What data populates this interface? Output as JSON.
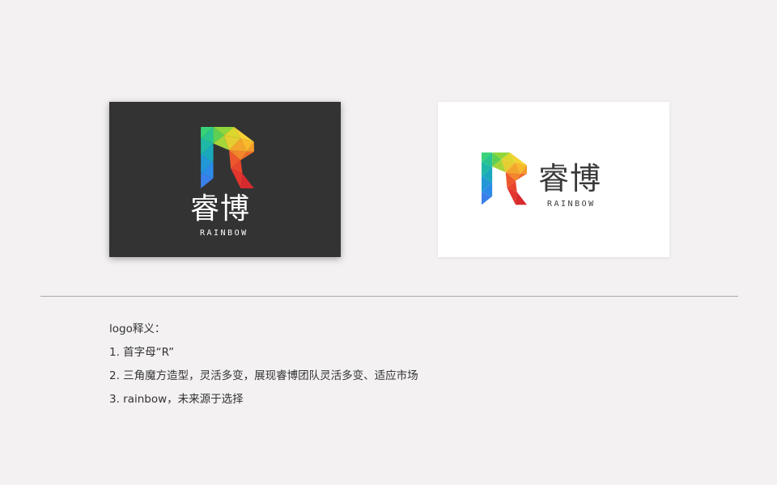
{
  "brand": {
    "name_cn": "睿博",
    "name_en": "RAINBOW"
  },
  "cards": {
    "dark_background": "#333333",
    "light_background": "#ffffff"
  },
  "logo_colors": {
    "green": "#2fc86e",
    "teal": "#1fb59a",
    "blue": "#2d8ee8",
    "yellow": "#f7d233",
    "orange": "#f59a2a",
    "red": "#e8382e"
  },
  "description": {
    "title": "logo释义：",
    "items": [
      "1. 首字母“R”",
      "2. 三角魔方造型，灵活多变，展现睿博团队灵活多变、适应市场",
      "3. rainbow，未来源于选择"
    ]
  }
}
